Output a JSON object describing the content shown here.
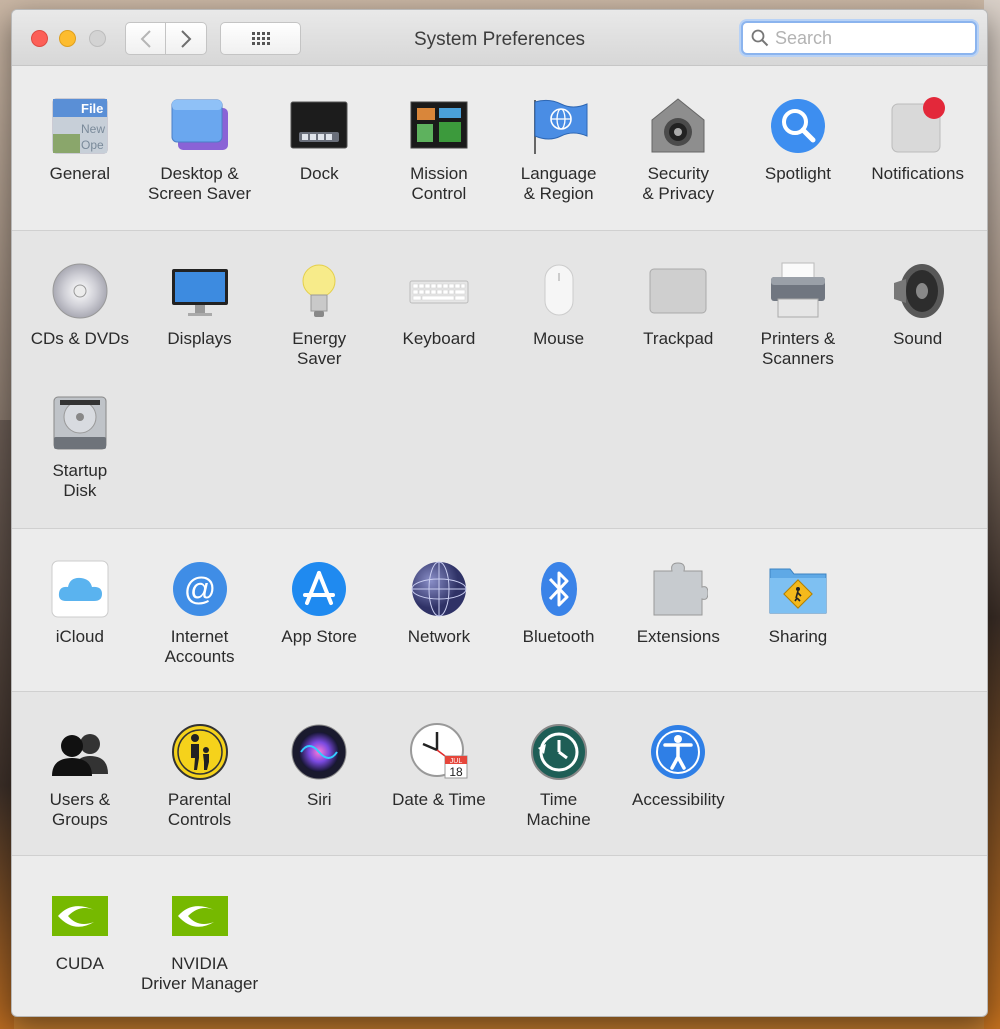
{
  "window": {
    "title": "System Preferences",
    "search_placeholder": "Search"
  },
  "sections": [
    {
      "items": [
        {
          "label": "General",
          "icon": "general-icon"
        },
        {
          "label": "Desktop &\nScreen Saver",
          "icon": "desktop-icon"
        },
        {
          "label": "Dock",
          "icon": "dock-icon"
        },
        {
          "label": "Mission\nControl",
          "icon": "mission-control-icon"
        },
        {
          "label": "Language\n& Region",
          "icon": "language-icon"
        },
        {
          "label": "Security\n& Privacy",
          "icon": "security-icon"
        },
        {
          "label": "Spotlight",
          "icon": "spotlight-icon"
        },
        {
          "label": "Notifications",
          "icon": "notifications-icon"
        }
      ]
    },
    {
      "items": [
        {
          "label": "CDs & DVDs",
          "icon": "cd-icon"
        },
        {
          "label": "Displays",
          "icon": "displays-icon"
        },
        {
          "label": "Energy\nSaver",
          "icon": "energy-icon"
        },
        {
          "label": "Keyboard",
          "icon": "keyboard-icon"
        },
        {
          "label": "Mouse",
          "icon": "mouse-icon"
        },
        {
          "label": "Trackpad",
          "icon": "trackpad-icon"
        },
        {
          "label": "Printers &\nScanners",
          "icon": "printer-icon"
        },
        {
          "label": "Sound",
          "icon": "sound-icon"
        },
        {
          "label": "Startup\nDisk",
          "icon": "disk-icon"
        }
      ]
    },
    {
      "items": [
        {
          "label": "iCloud",
          "icon": "icloud-icon"
        },
        {
          "label": "Internet\nAccounts",
          "icon": "internet-accounts-icon"
        },
        {
          "label": "App Store",
          "icon": "app-store-icon"
        },
        {
          "label": "Network",
          "icon": "network-icon"
        },
        {
          "label": "Bluetooth",
          "icon": "bluetooth-icon"
        },
        {
          "label": "Extensions",
          "icon": "extensions-icon"
        },
        {
          "label": "Sharing",
          "icon": "sharing-icon"
        }
      ]
    },
    {
      "items": [
        {
          "label": "Users &\nGroups",
          "icon": "users-icon"
        },
        {
          "label": "Parental\nControls",
          "icon": "parental-icon"
        },
        {
          "label": "Siri",
          "icon": "siri-icon"
        },
        {
          "label": "Date & Time",
          "icon": "clock-icon"
        },
        {
          "label": "Time\nMachine",
          "icon": "time-machine-icon"
        },
        {
          "label": "Accessibility",
          "icon": "accessibility-icon"
        }
      ]
    },
    {
      "items": [
        {
          "label": "CUDA",
          "icon": "nvidia-icon"
        },
        {
          "label": "NVIDIA\nDriver Manager",
          "icon": "nvidia-icon"
        }
      ]
    }
  ],
  "icon_text": {
    "general": [
      "File",
      "New",
      "Ope"
    ],
    "calendar_month": "JUL",
    "calendar_day": "18"
  }
}
